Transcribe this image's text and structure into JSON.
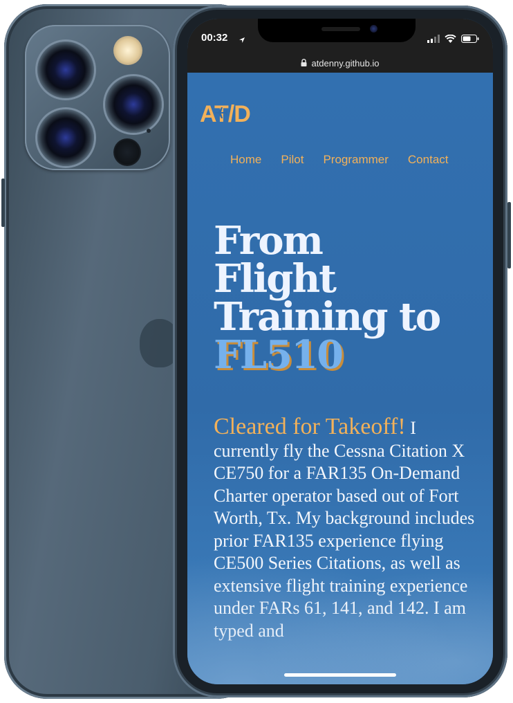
{
  "status_bar": {
    "time": "00:32"
  },
  "browser": {
    "url": "atdenny.github.io"
  },
  "site": {
    "logo": "AT/D",
    "nav": [
      "Home",
      "Pilot",
      "Programmer",
      "Contact"
    ],
    "hero": {
      "line1": "From",
      "line2": "Flight",
      "line3": "Training to",
      "accent": "FL510"
    },
    "intro": {
      "lead": "Cleared for Takeoff!",
      "body": "I currently fly the Cessna Citation X CE750 for a FAR135 On-Demand Charter operator based out of Fort Worth, Tx. My background includes prior FAR135 experience flying CE500 Series Citations, as well as extensive flight training experience under FARs 61, 141, and 142. I am typed and"
    }
  },
  "colors": {
    "site_background": "#306ba9",
    "accent_orange": "#f2b15a",
    "accent_blue": "#76b1ec",
    "phone_frame": "#4a5d6d"
  },
  "icons": [
    "location-arrow-icon",
    "signal-icon",
    "wifi-icon",
    "battery-icon",
    "lock-icon",
    "airplane-icon"
  ]
}
